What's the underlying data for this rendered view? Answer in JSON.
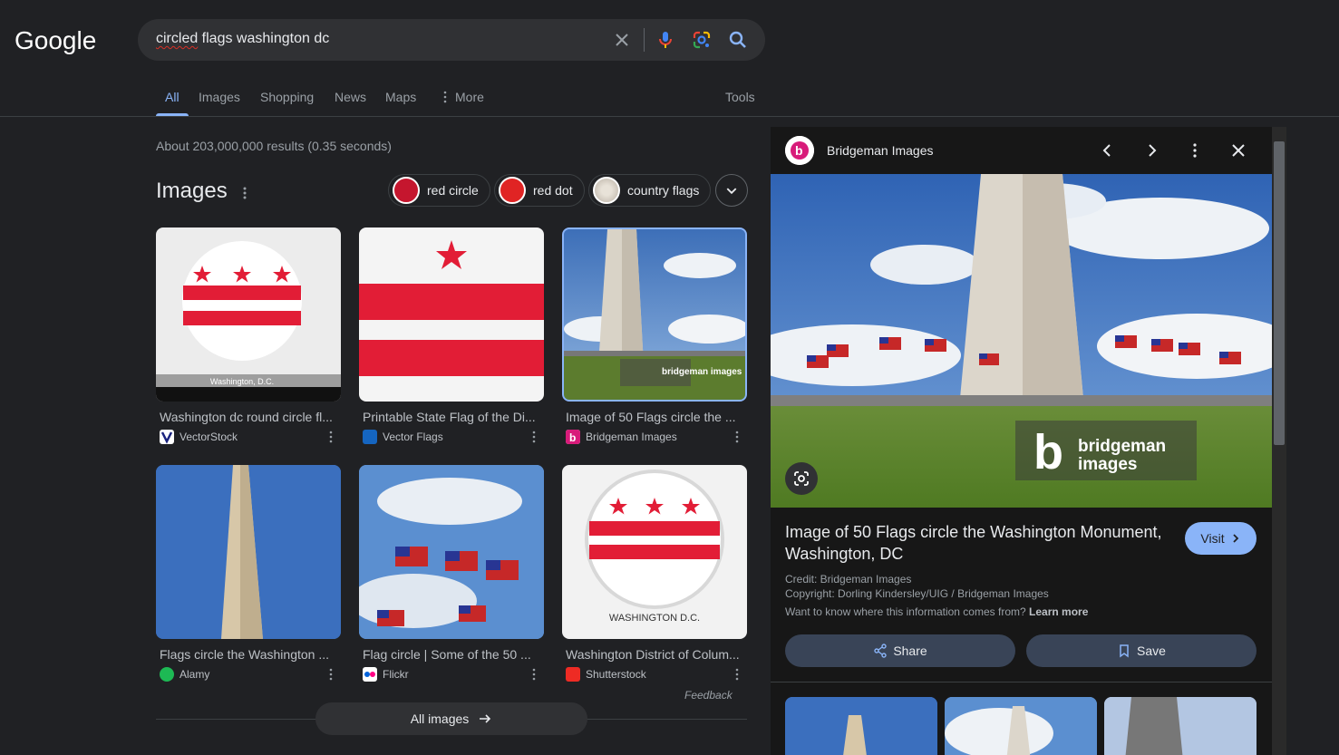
{
  "header": {
    "logo_text": "Google",
    "search_query_underlined": "circled",
    "search_query_rest": " flags washington dc"
  },
  "tabs": [
    {
      "label": "All",
      "active": true
    },
    {
      "label": "Images"
    },
    {
      "label": "Shopping"
    },
    {
      "label": "News"
    },
    {
      "label": "Maps"
    },
    {
      "label": "More"
    }
  ],
  "tools_label": "Tools",
  "result_stats": "About 203,000,000 results (0.35 seconds)",
  "images_section": {
    "heading": "Images",
    "chips": [
      {
        "label": "red circle",
        "color": "#c5162e"
      },
      {
        "label": "red dot",
        "color": "#e02424"
      },
      {
        "label": "country flags",
        "color": "#d9d2c8"
      }
    ],
    "results": [
      {
        "title": "Washington dc round circle fl...",
        "source": "VectorStock",
        "caption": "Washington, D.C."
      },
      {
        "title": "Printable State Flag of the Di...",
        "source": "Vector Flags"
      },
      {
        "title": "Image of 50 Flags circle the ...",
        "source": "Bridgeman Images",
        "watermark": "bridgeman images"
      },
      {
        "title": "Flags circle the Washington ...",
        "source": "Alamy"
      },
      {
        "title": "Flag circle | Some of the 50 ...",
        "source": "Flickr"
      },
      {
        "title": "Washington District of Colum...",
        "source": "Shutterstock",
        "caption": "WASHINGTON D.C."
      }
    ],
    "feedback": "Feedback",
    "all_images_label": "All images"
  },
  "panel": {
    "source": "Bridgeman Images",
    "watermark_line1": "bridgeman",
    "watermark_line2": "images",
    "title": "Image of 50 Flags circle the Washington Monument, Washington, DC",
    "visit_label": "Visit",
    "credit": "Credit: Bridgeman Images",
    "copyright": "Copyright: Dorling Kindersley/UIG / Bridgeman Images",
    "info_text": "Want to know where this information comes from?",
    "learn_more": "Learn more",
    "share_label": "Share",
    "save_label": "Save"
  },
  "colors": {
    "background": "#202124",
    "accent": "#8ab4f8",
    "flag_red": "#e21d36"
  }
}
